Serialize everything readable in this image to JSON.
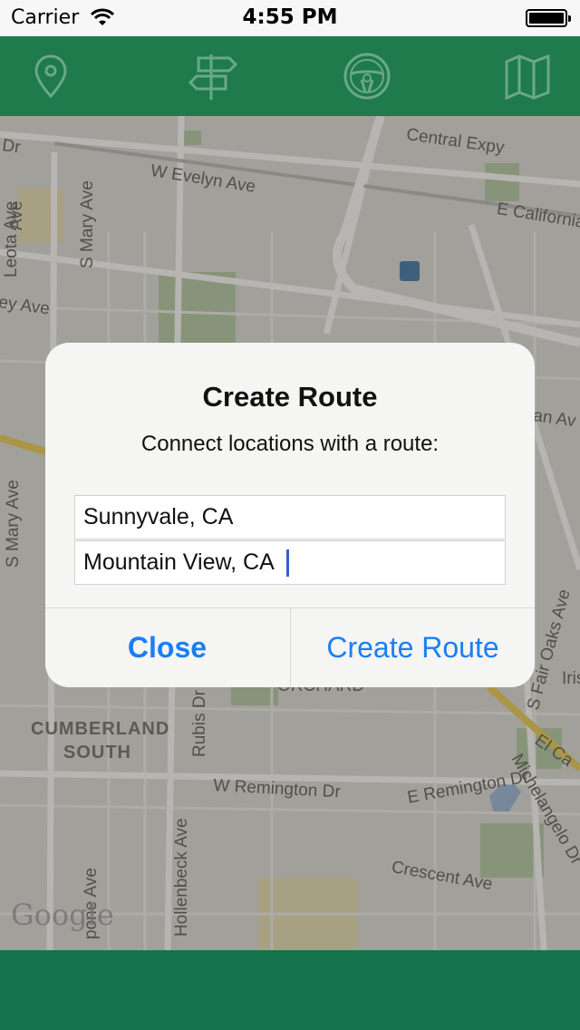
{
  "status_bar": {
    "carrier": "Carrier",
    "time": "4:55 PM"
  },
  "toolbar": {
    "color": "#1f7a4c",
    "icons": [
      "location-pin-icon",
      "signpost-icon",
      "steering-wheel-icon",
      "map-icon"
    ]
  },
  "map": {
    "labels": {
      "dr": "Dr",
      "central_expy": "Central Expy",
      "w_evelyn_ave": "W Evelyn Ave",
      "e_california": "E California",
      "s_mary_ave_1": "S Mary Ave",
      "s_mary_ave_2": "S Mary Ave",
      "ave_left": "Ave",
      "leota_ave": "Leota Ave",
      "ey_ave": "ey Ave",
      "an_av": "an Av",
      "s_fair_oaks_ave": "S Fair Oaks Ave",
      "iris": "Iris",
      "cumberland": "CUMBERLAND",
      "south": "SOUTH",
      "rubis_dr": "Rubis Dr",
      "w_remington_dr": "W Remington Dr",
      "e_remington_dr": "E Remington Dr",
      "michelangelo_dr": "Michelangelo Dr",
      "el_ca": "El Ca",
      "crescent_ave": "Crescent Ave",
      "hollenbeck_ave": "Hollenbeck Ave",
      "pone_ave": "pone Ave",
      "orchard": "ORCHARD"
    },
    "attribution": "Google"
  },
  "dialog": {
    "title": "Create Route",
    "message": "Connect locations with a route:",
    "field1_value": "Sunnyvale, CA",
    "field2_value": "Mountain View, CA",
    "close_label": "Close",
    "create_label": "Create Route",
    "button_color": "#1a7ff5"
  },
  "bottom_bar": {
    "color": "#14734a"
  }
}
